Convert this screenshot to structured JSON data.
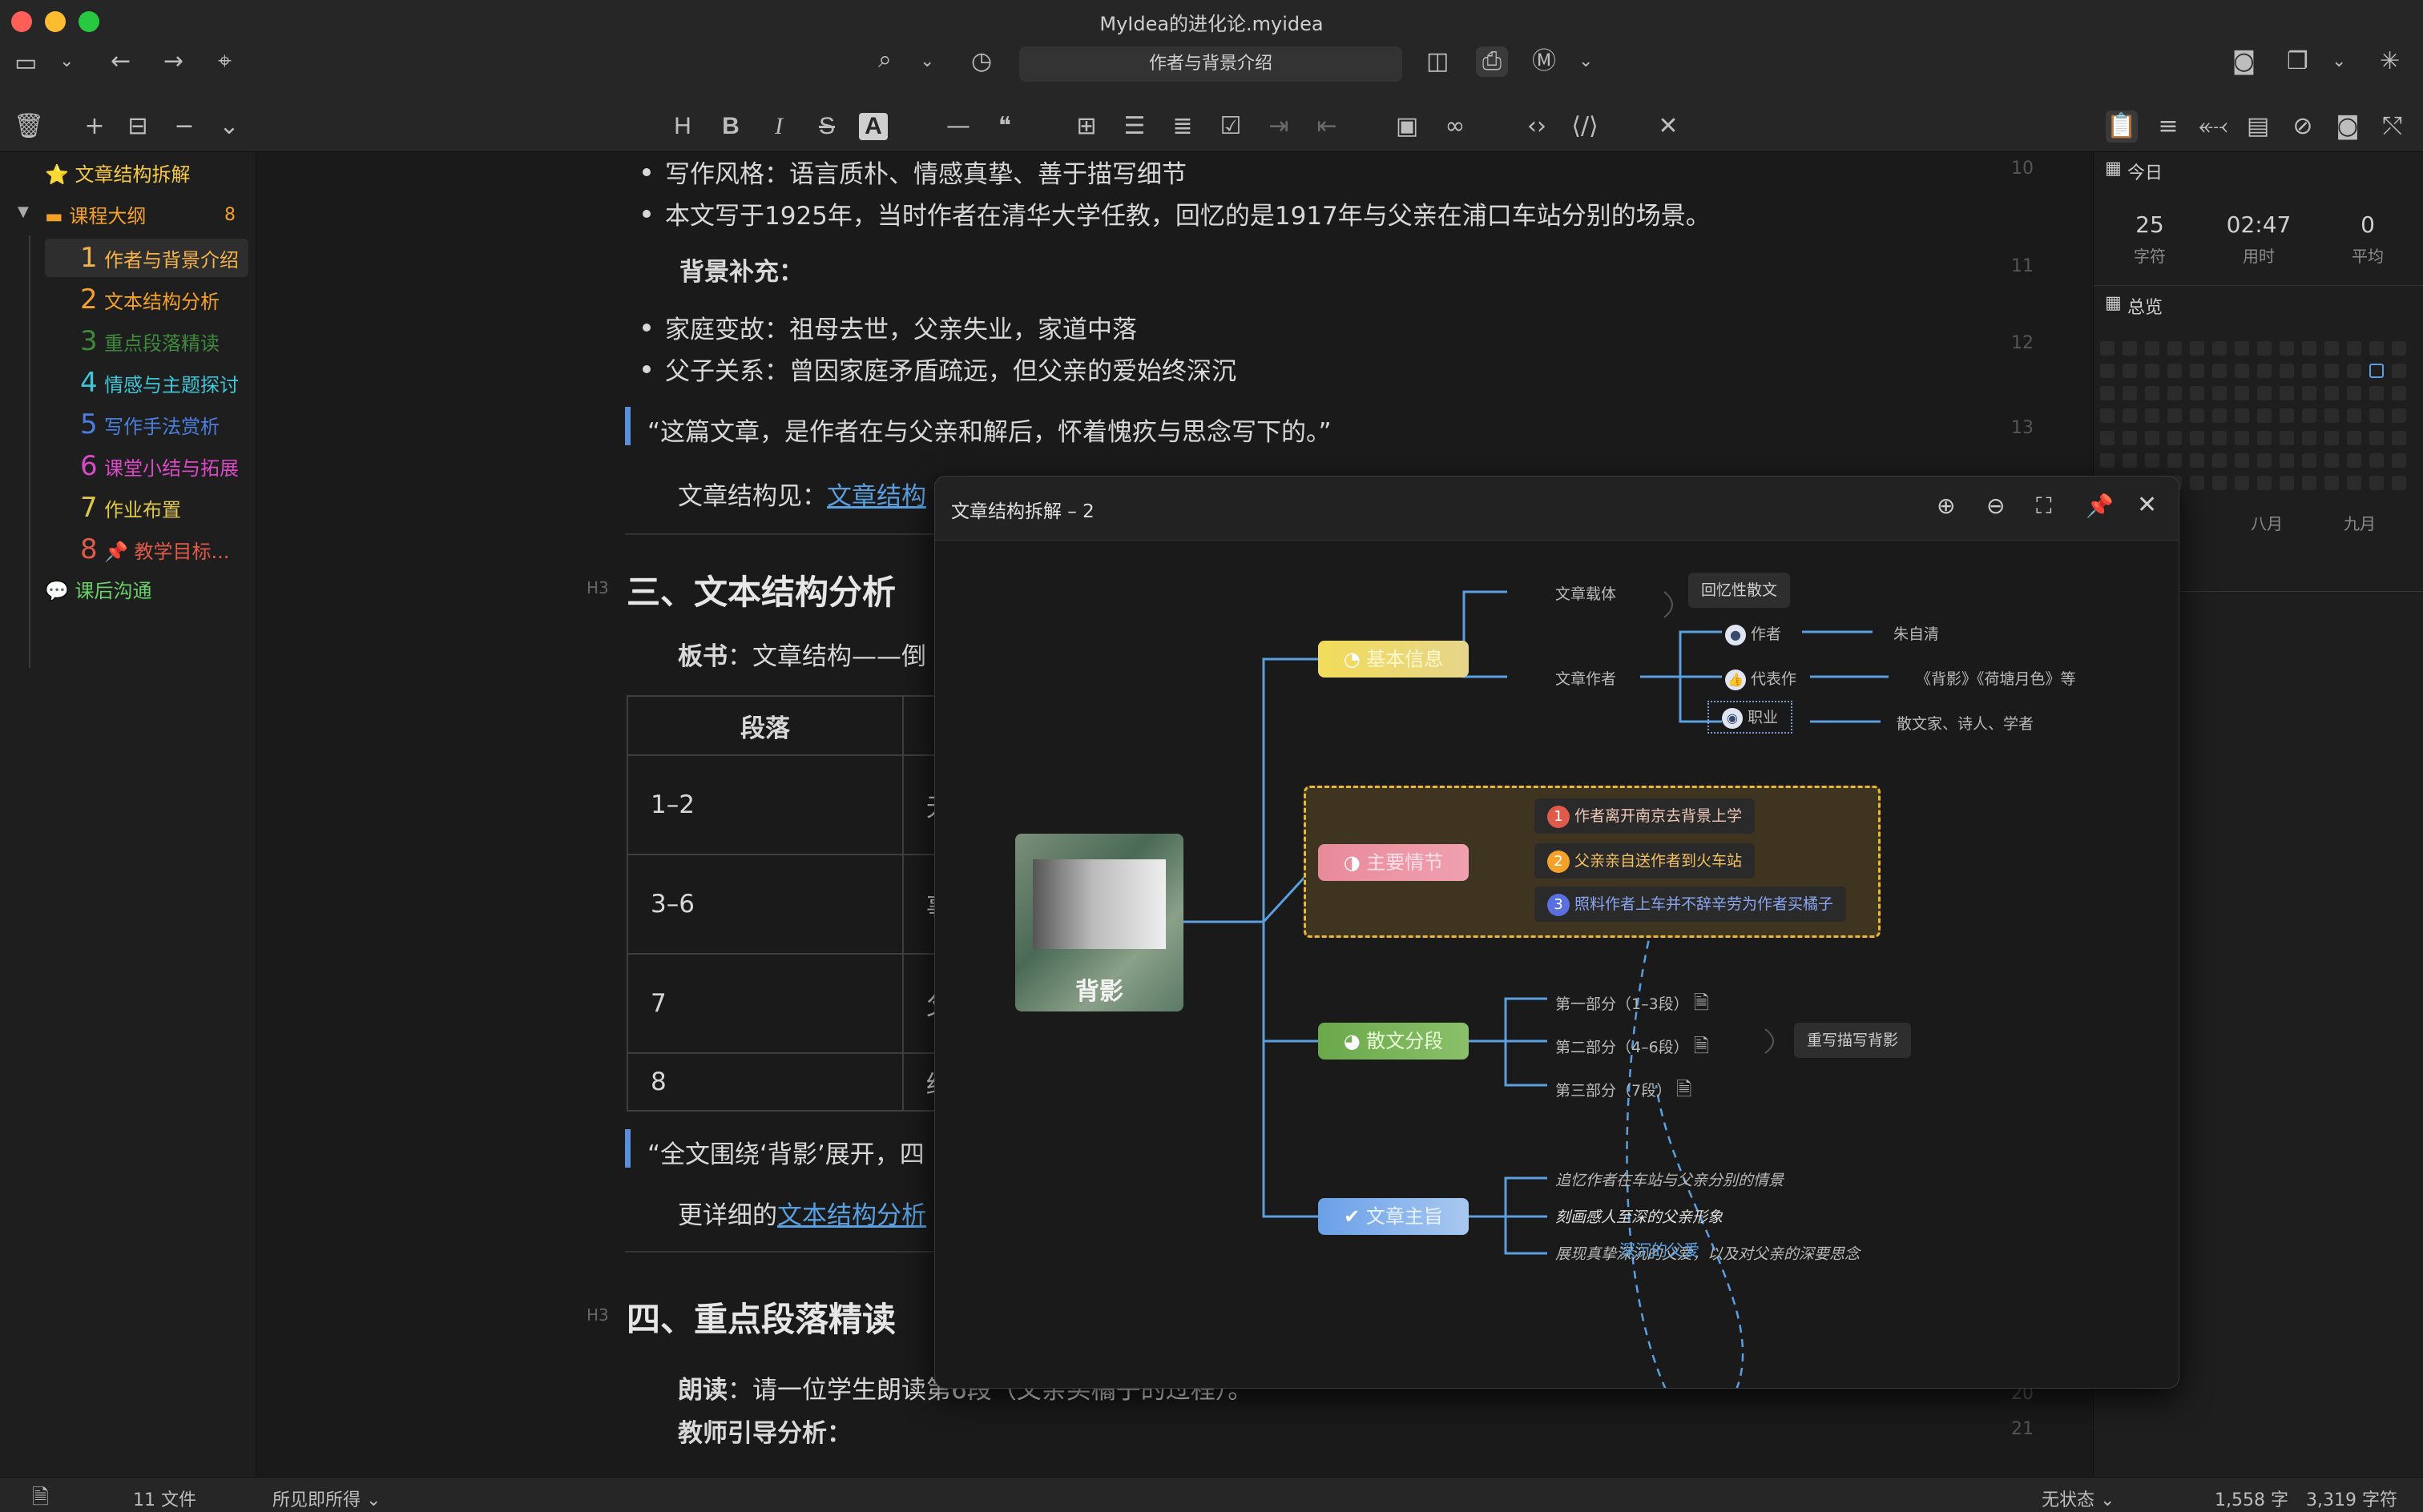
{
  "window": {
    "title": "MyIdea的进化论.myidea"
  },
  "toolbar": {
    "breadcrumb": "作者与背景介绍",
    "icons": [
      "sidebar-toggle-icon",
      "chevron-down-icon",
      "back-arrow-icon",
      "forward-arrow-icon",
      "locate-icon",
      "search-icon",
      "chevron-down-icon",
      "history-icon",
      "split-view-icon",
      "print-icon",
      "markdown-icon",
      "chevron-down-icon",
      "camera-icon",
      "copy-icon",
      "chevron-down-icon",
      "sparkle-icon"
    ]
  },
  "format_toolbar": {
    "left": [
      "trash-icon",
      "add-icon",
      "add-child-icon",
      "remove-icon",
      "chevron-down-icon"
    ],
    "tools": [
      "H",
      "B",
      "I",
      "S",
      "A"
    ]
  },
  "sidebar": {
    "items": [
      {
        "label": "文章结构拆解",
        "color": "#f4c94a"
      },
      {
        "label": "课程大纲",
        "badge": "8",
        "color": "#f4a12a"
      },
      {
        "num": "1",
        "label": "作者与背景介绍",
        "color": "#f4b24a"
      },
      {
        "num": "2",
        "label": "文本结构分析",
        "color": "#f4a12a"
      },
      {
        "num": "3",
        "label": "重点段落精读",
        "color": "#3d8a3d"
      },
      {
        "num": "4",
        "label": "情感与主题探讨",
        "color": "#3ec6d8"
      },
      {
        "num": "5",
        "label": "写作手法赏析",
        "color": "#4a7fe0"
      },
      {
        "num": "6",
        "label": "课堂小结与拓展",
        "color": "#d84ac6"
      },
      {
        "num": "7",
        "label": "作业布置",
        "color": "#e0c84a"
      },
      {
        "num": "8",
        "label": "📌 教学目标...",
        "color": "#e05a4a"
      },
      {
        "label": "课后沟通",
        "color": "#6ad06a"
      }
    ]
  },
  "editor": {
    "lines": {
      "l10": "写作风格：语言质朴、情感真挚、善于描写细节",
      "l10b": "本文写于1925年，当时作者在清华大学任教，回忆的是1917年与父亲在浦口车站分别的场景。",
      "l11": "背景补充：",
      "l12a": "家庭变故：祖母去世，父亲失业，家道中落",
      "l12b": "父子关系：曾因家庭矛盾疏远，但父亲的爱始终深沉",
      "l13": "“这篇文章，是作者在与父亲和解后，怀着愧疚与思念写下的。”",
      "l14_prefix": "文章结构见：",
      "l14_link": "文章结构",
      "h3a": "三、文本结构分析",
      "board_label": "板书",
      "board_text": "：文章结构——倒",
      "table_header": "段落",
      "table_rows": [
        "1–2",
        "3–6",
        "7",
        "8"
      ],
      "table_col2": [
        "无",
        "事",
        "父",
        "结"
      ],
      "quote2": "“全文围绕‘背影’展开，四",
      "more_prefix": "更详细的",
      "more_link": "文本结构分析",
      "h3b": "四、重点段落精读",
      "read_label": "朗读",
      "read_text": "：请一位学生朗读第6段（父亲买橘子的过程）。",
      "teach": "教师引导分析："
    },
    "line_numbers": [
      "10",
      "11",
      "12",
      "13",
      "20",
      "21"
    ],
    "h3_tag": "H3"
  },
  "right_panel": {
    "today_label": "今日",
    "stats": [
      {
        "value": "25",
        "label": "字符"
      },
      {
        "value": "02:47",
        "label": "用时"
      },
      {
        "value": "0",
        "label": "平均"
      }
    ],
    "overview_label": "总览",
    "months": [
      "八月",
      "九月"
    ]
  },
  "mindmap": {
    "title": "文章结构拆解 – 2",
    "central": "背影",
    "branches": {
      "basic": "基本信息",
      "plot": "主要情节",
      "sections": "散文分段",
      "theme": "文章主旨"
    },
    "basic": {
      "genre_label": "文章载体",
      "genre_value": "回忆性散文",
      "author_label": "文章作者",
      "author": "作者",
      "author_value": "朱自清",
      "works": "代表作",
      "works_value": "《背影》《荷塘月色》等",
      "job": "职业",
      "job_value": "散文家、诗人、学者"
    },
    "plot": [
      {
        "n": "1",
        "text": "作者离开南京去背景上学",
        "color": "#e05a4a"
      },
      {
        "n": "2",
        "text": "父亲亲自送作者到火车站",
        "color": "#f4a12a"
      },
      {
        "n": "3",
        "text": "照料作者上车并不辞辛劳为作者买橘子",
        "color": "#5a6fe0"
      }
    ],
    "sections": [
      "第一部分（1–3段）",
      "第二部分（4–6段）",
      "第三部分（7段）"
    ],
    "sections_note": "重写描写背影",
    "theme": [
      "追忆作者在车站与父亲分别的情景",
      "刻画感人至深的父亲形象",
      "展现真挚深沉的父爱，以及对父亲的深要思念"
    ],
    "theme_overlay": "深沉的父爱"
  },
  "status": {
    "files": "11 文件",
    "mode": "所见即所得",
    "state": "无状态",
    "words": "1,558 字",
    "chars": "3,319 字符"
  }
}
